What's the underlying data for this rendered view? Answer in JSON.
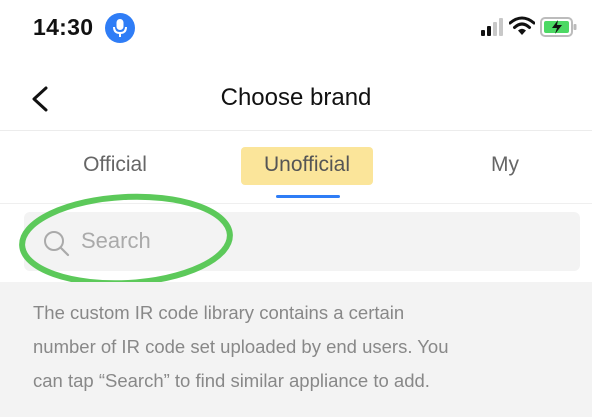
{
  "status_bar": {
    "time": "14:30"
  },
  "header": {
    "title": "Choose brand"
  },
  "tabs": [
    {
      "label": "Official"
    },
    {
      "label": "Unofficial"
    },
    {
      "label": "My"
    }
  ],
  "active_tab": "Unofficial",
  "search": {
    "placeholder": "Search",
    "value": ""
  },
  "info": {
    "lines": [
      "The custom IR code library contains a certain",
      "number of IR code set uploaded by end users. You",
      "can tap “Search” to find similar appliance to add."
    ]
  },
  "colors": {
    "accent": "#2f7df6",
    "tab_highlight": "#fbe59a",
    "annotation": "#5cc95a",
    "battery": "#4cd964"
  },
  "icons": [
    "microphone-icon",
    "signal-icon",
    "wifi-icon",
    "battery-charging-icon",
    "back-icon",
    "search-icon"
  ]
}
